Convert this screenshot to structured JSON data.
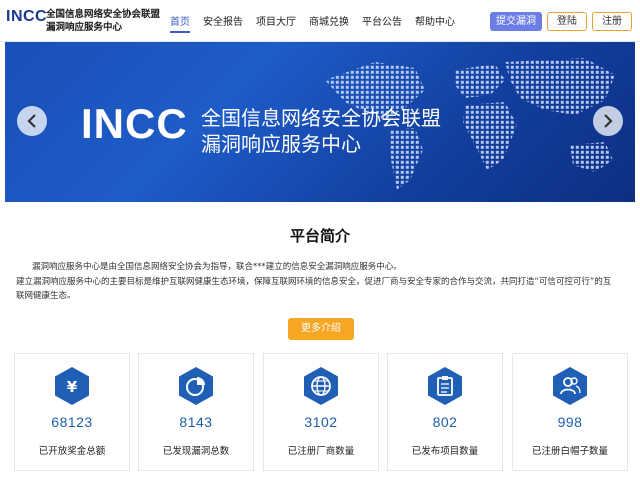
{
  "header": {
    "logo": "INCC",
    "org_line1": "全国信息网络安全协会联盟",
    "org_line2": "漏洞响应服务中心",
    "nav": [
      {
        "label": "首页",
        "active": true
      },
      {
        "label": "安全报告",
        "active": false
      },
      {
        "label": "项目大厅",
        "active": false
      },
      {
        "label": "商城兑换",
        "active": false
      },
      {
        "label": "平台公告",
        "active": false
      },
      {
        "label": "帮助中心",
        "active": false
      }
    ],
    "submit_label": "提交漏洞",
    "login_label": "登陆",
    "register_label": "注册"
  },
  "banner": {
    "title": "INCC",
    "sub1": "全国信息网络安全协会联盟",
    "sub2": "漏洞响应服务中心"
  },
  "intro": {
    "title": "平台简介",
    "p1": "漏洞响应服务中心是由全国信息网络安全协会为指导，联合***建立的信息安全漏洞响应服务中心。",
    "p2": "建立漏洞响应服务中心的主要目标是维护互联网健康生态环境，保障互联网环境的信息安全，促进厂商与安全专家的合作与交流，共同打造“可信可控可行”的互联网健康生态。",
    "more_label": "更多介绍"
  },
  "stats": [
    {
      "icon": "yen-icon",
      "value": "68123",
      "label": "已开放奖金总额"
    },
    {
      "icon": "pie-chart-icon",
      "value": "8143",
      "label": "已发现漏洞总数"
    },
    {
      "icon": "globe-icon",
      "value": "3102",
      "label": "已注册厂商数量"
    },
    {
      "icon": "clipboard-icon",
      "value": "802",
      "label": "已发布项目数量"
    },
    {
      "icon": "users-icon",
      "value": "998",
      "label": "已注册白帽子数量"
    }
  ],
  "colors": {
    "brand": "#1b3a8f",
    "nav_active": "#3a5bc7",
    "submit_btn": "#6d7de6",
    "accent_orange": "#f5a623",
    "stat_number": "#1c5fa8",
    "hex_icon": "#1f5fb5"
  }
}
